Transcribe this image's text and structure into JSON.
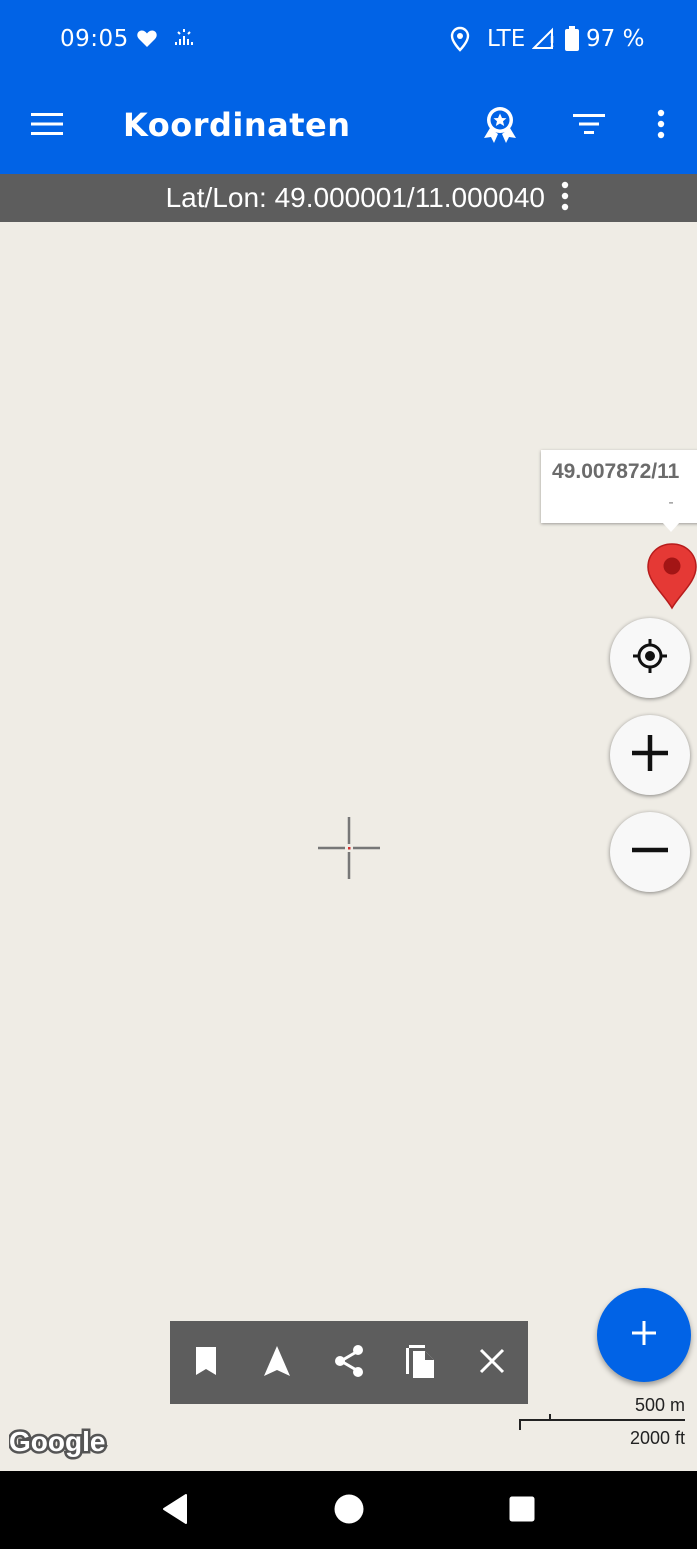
{
  "status_bar": {
    "time": "09:05",
    "network": "LTE",
    "battery": "97 %",
    "icons": [
      "heart-icon",
      "sparkle-icon",
      "location-pin-icon",
      "signal-icon",
      "battery-icon"
    ]
  },
  "app_bar": {
    "title": "Koordinaten",
    "icons": [
      "menu-icon",
      "award-icon",
      "filter-icon",
      "more-vert-icon"
    ]
  },
  "coord_bar": {
    "text": "Lat/Lon: 49.000001/11.000040"
  },
  "map": {
    "info_window_title": "49.007872/11",
    "info_window_snippet": "-",
    "marker_color": "#e53935",
    "controls": [
      "my-location-icon",
      "zoom-in-icon",
      "zoom-out-icon"
    ]
  },
  "action_toolbar": {
    "icons": [
      "bookmark-icon",
      "navigate-icon",
      "share-icon",
      "copy-icon",
      "close-icon"
    ]
  },
  "scale": {
    "metric": "500 m",
    "imperial": "2000 ft"
  },
  "attribution": "Google",
  "colors": {
    "primary": "#0163e6",
    "bar_gray": "#5d5d5d",
    "map_bg": "#efece5"
  }
}
